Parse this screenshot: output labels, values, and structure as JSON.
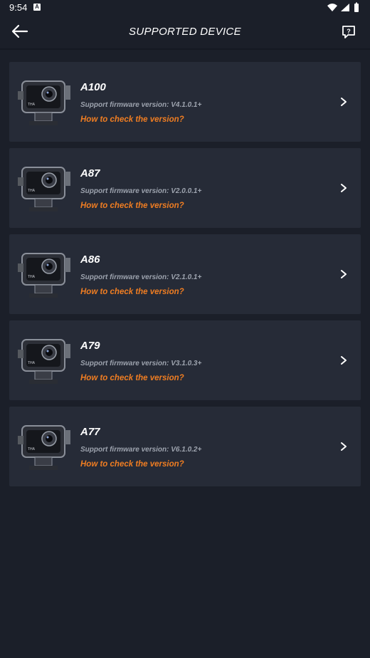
{
  "status_bar": {
    "time": "9:54",
    "notif_letter": "A"
  },
  "header": {
    "title": "SUPPORTED DEVICE"
  },
  "devices": [
    {
      "model": "A100",
      "firmware": "Support firmware version: V4.1.0.1+",
      "link": "How to check the version?"
    },
    {
      "model": "A87",
      "firmware": "Support firmware version: V2.0.0.1+",
      "link": "How to check the version?"
    },
    {
      "model": "A86",
      "firmware": "Support firmware version: V2.1.0.1+",
      "link": "How to check the version?"
    },
    {
      "model": "A79",
      "firmware": "Support firmware version: V3.1.0.3+",
      "link": "How to check the version?"
    },
    {
      "model": "A77",
      "firmware": "Support firmware version: V6.1.0.2+",
      "link": "How to check the version?"
    }
  ],
  "colors": {
    "background": "#1b1f29",
    "card": "#262b37",
    "accent": "#ef7d22",
    "muted": "#9da3ae"
  },
  "icons": {
    "back": "arrow-left-icon",
    "help": "help-bubble-icon",
    "chevron": "chevron-right-icon",
    "device": "action-camera-image"
  }
}
